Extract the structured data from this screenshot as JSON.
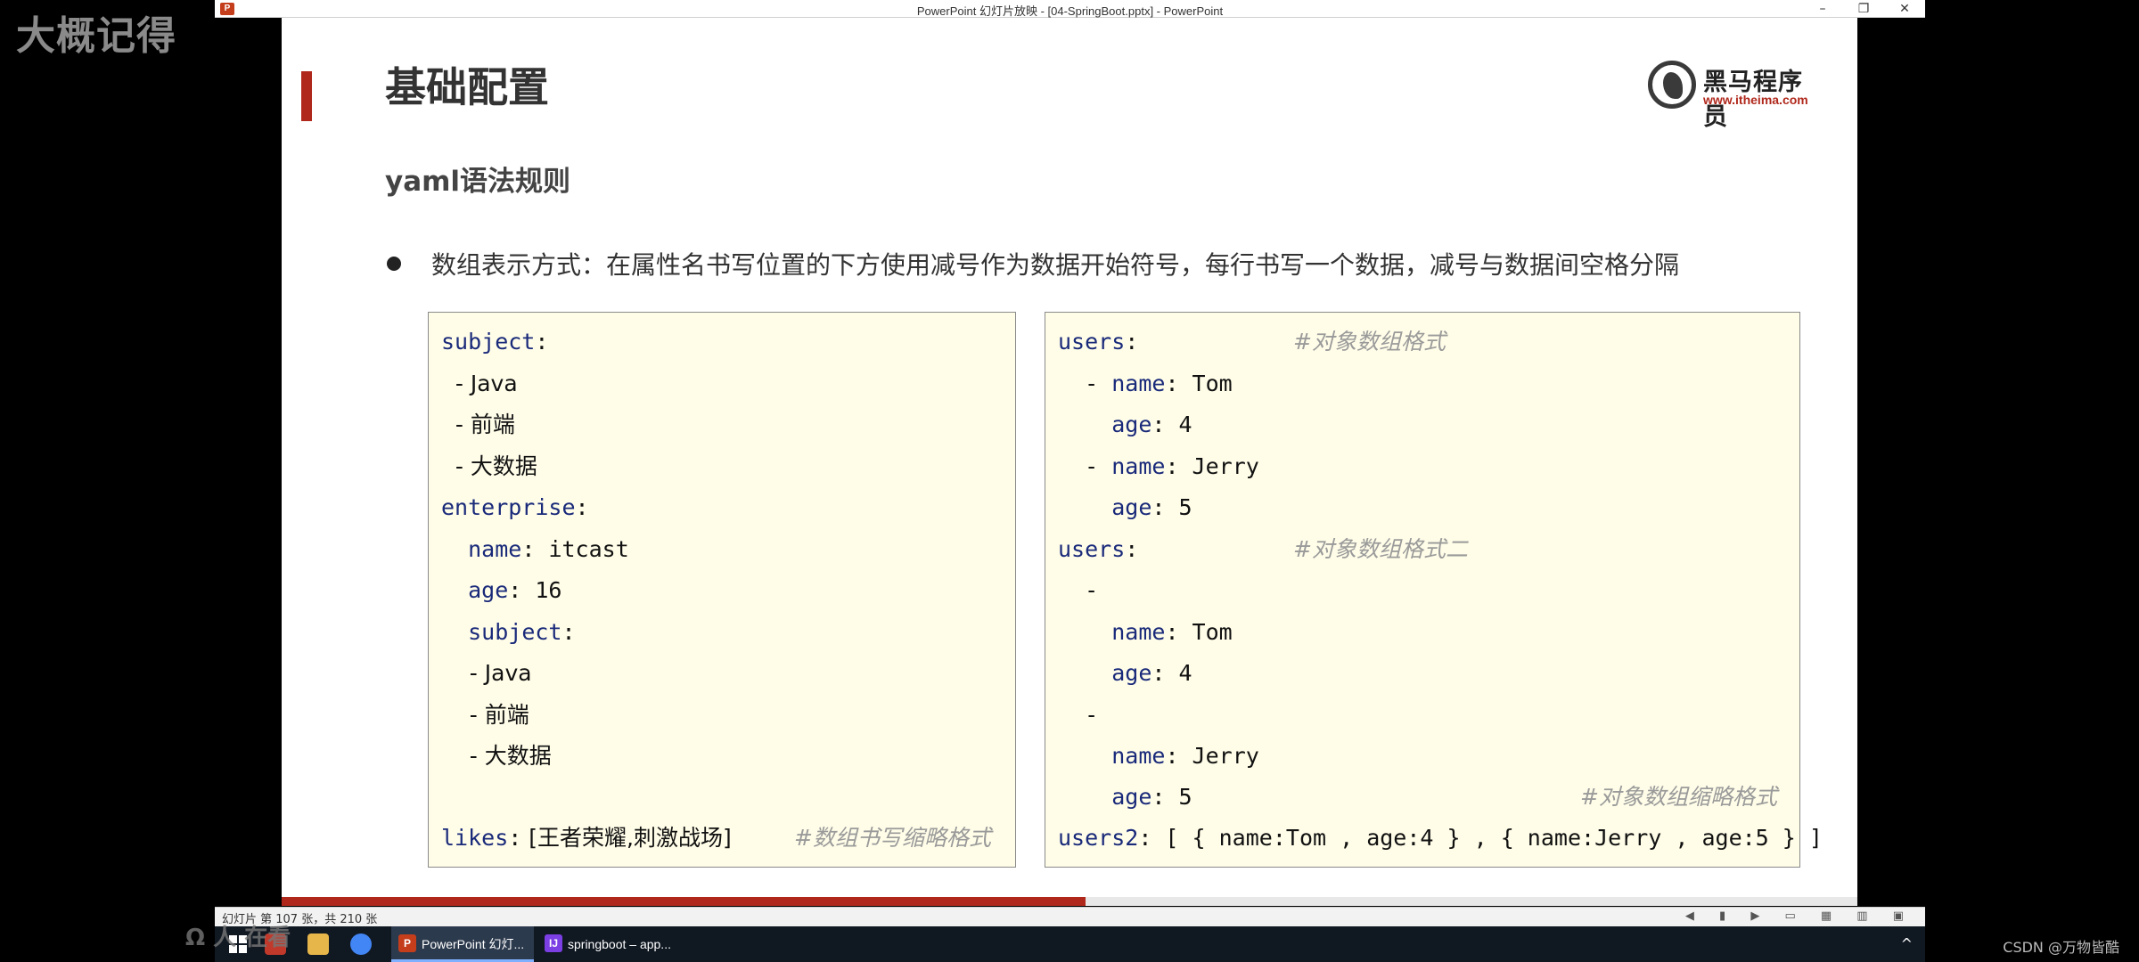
{
  "watermarks": {
    "top_left": "大概记得",
    "slide_overlay": "黑",
    "bottom_left": "Ω 人 在看",
    "bottom_right": "CSDN @万物皆酷"
  },
  "window": {
    "title": "PowerPoint 幻灯片放映 - [04-SpringBoot.pptx] - PowerPoint",
    "app_icon_letter": "P",
    "minimize": "–",
    "maximize": "❐",
    "close": "✕"
  },
  "slide": {
    "title": "基础配置",
    "logo_name": "黑马程序员",
    "logo_url": "www.itheima.com",
    "subtitle": "yaml语法规则",
    "bullet": "数组表示方式：在属性名书写位置的下方使用减号作为数据开始符号，每行书写一个数据，减号与数据间空格分隔",
    "left_code": {
      "l1_key": "subject",
      "l2": "  - Java",
      "l3": "  - 前端",
      "l4": "  - 大数据",
      "l5_key": "enterprise",
      "l6_key": "name",
      "l6_val": " itcast",
      "l7_key": "age",
      "l7_val": " 16",
      "l8_key": "subject",
      "l9": "    - Java",
      "l10": "    - 前端",
      "l11": "    - 大数据",
      "l12_key": "likes",
      "l12_val": " [王者荣耀,刺激战场]",
      "l12_comment": "#数组书写缩略格式"
    },
    "right_code": {
      "r1_key": "users",
      "r1_comment": "#对象数组格式",
      "r2_prefix": "  - ",
      "r2_key": "name",
      "r2_val": " Tom",
      "r3_key": "age",
      "r3_val": " 4",
      "r4_prefix": "  - ",
      "r4_key": "name",
      "r4_val": " Jerry",
      "r5_key": "age",
      "r5_val": " 5",
      "r6_key": "users",
      "r6_comment": "#对象数组格式二",
      "r7": "  -",
      "r8_key": "name",
      "r8_val": " Tom",
      "r9_key": "age",
      "r9_val": " 4",
      "r10": "  -",
      "r11_key": "name",
      "r11_val": " Jerry",
      "r12_key": "age",
      "r12_val": " 5",
      "r12_comment": "#对象数组缩略格式",
      "r13_key": "users2",
      "r13_val": " [ { name:Tom , age:4 } , { name:Jerry , age:5 } ]"
    },
    "progress_fraction": 0.51
  },
  "statusbar": {
    "info": "幻灯片 第 107 张，共 210 张",
    "icons": "◀ ▮ ▶ ▭ ▦ ▥ ▣"
  },
  "taskbar": {
    "apps": [
      {
        "label": "PowerPoint 幻灯...",
        "glyph": "P"
      },
      {
        "label": "springboot – app...",
        "glyph": "IJ"
      }
    ],
    "caret": "^"
  },
  "colors": {
    "accent": "#b0281c",
    "code_bg": "#fffde8",
    "code_key": "#1a2a7a",
    "comment": "#9a9a9a"
  }
}
